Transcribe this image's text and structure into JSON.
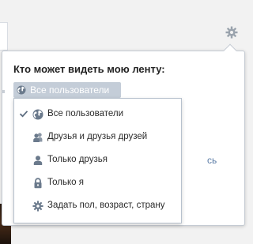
{
  "popup": {
    "title": "Кто может видеть мою ленту:",
    "selected": "Все пользователи"
  },
  "background": {
    "partial_text": "сь"
  },
  "dropdown": {
    "items": [
      {
        "label": "Все пользователи",
        "icon": "globe-icon",
        "checked": true
      },
      {
        "label": "Друзья и друзья друзей",
        "icon": "friends-of-friends-icon",
        "checked": false
      },
      {
        "label": "Только друзья",
        "icon": "person-icon",
        "checked": false
      },
      {
        "label": "Только я",
        "icon": "lock-icon",
        "checked": false
      },
      {
        "label": "Задать пол, возраст, страну",
        "icon": "gear-icon",
        "checked": false
      }
    ]
  },
  "colors": {
    "chip": "#c4cdd8",
    "icon": "#6b7a8c",
    "link": "#5a7ba5"
  }
}
